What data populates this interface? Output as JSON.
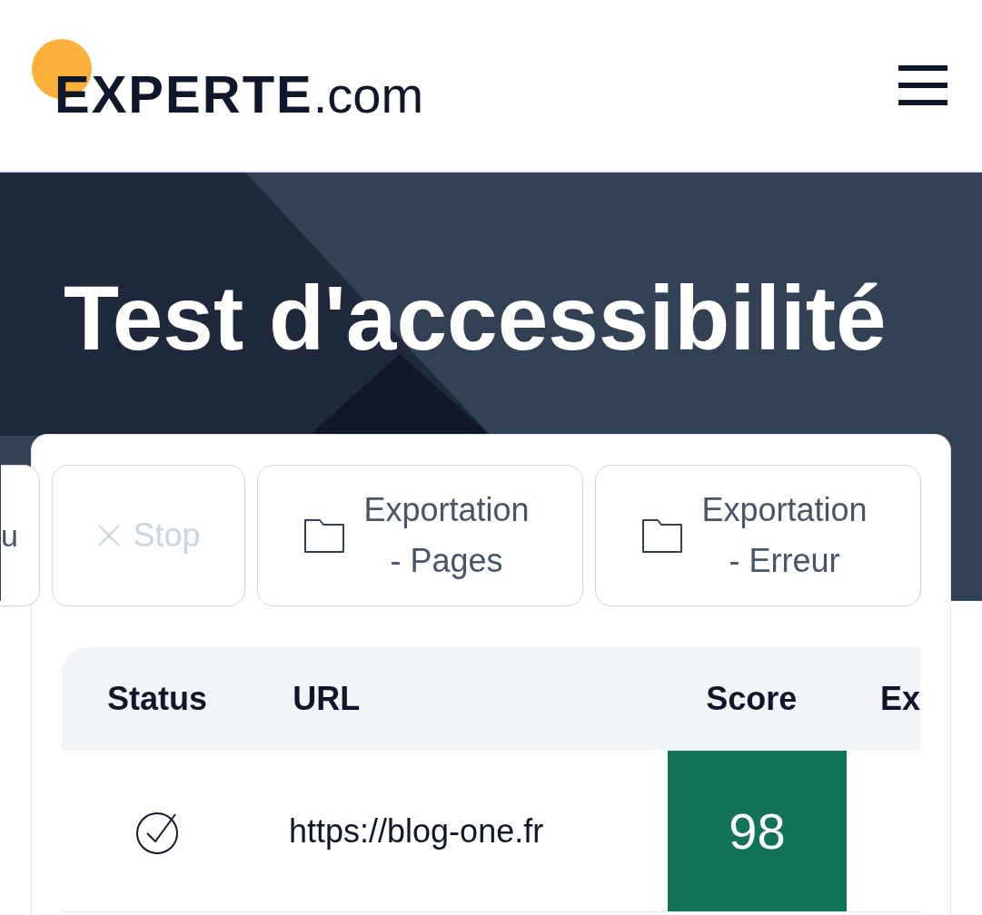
{
  "logo": {
    "brand": "EXPERTE",
    "suffix": ".com"
  },
  "hero": {
    "title": "Test d'accessibilité"
  },
  "actions": [
    {
      "label": "u",
      "kind": "partial",
      "disabled": false
    },
    {
      "label": "Stop",
      "kind": "stop",
      "disabled": true
    },
    {
      "label": "Exportation - Pages",
      "kind": "export",
      "disabled": false
    },
    {
      "label": "Exportation - Erreur",
      "kind": "export",
      "disabled": false
    }
  ],
  "table": {
    "columns": [
      "Status",
      "URL",
      "Score",
      "Ex"
    ],
    "rows": [
      {
        "kind": "ok",
        "url": "https://blog-one.fr",
        "score": "98",
        "color": "#137356"
      }
    ]
  }
}
